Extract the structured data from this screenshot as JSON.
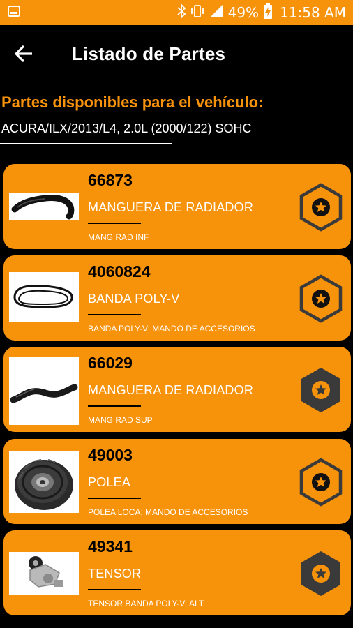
{
  "status_bar": {
    "battery_percent": "49%",
    "time": "11:58 AM",
    "icons": [
      "image-notification-icon",
      "bluetooth-icon",
      "vibrate-icon",
      "signal-icon",
      "battery-charging-icon"
    ]
  },
  "app_bar": {
    "back_icon": "arrow-left-icon",
    "title": "Listado de Partes"
  },
  "header": {
    "available_title": "Partes disponibles para el vehículo:",
    "vehicle": "ACURA/ILX/2013/L4, 2.0L (2000/122) SOHC"
  },
  "colors": {
    "accent": "#f7920b",
    "background": "#000000",
    "hex_dark": "#3a3a3a"
  },
  "parts": [
    {
      "number": "66873",
      "name": "MANGUERA DE RADIADOR",
      "description": "MANG RAD INF",
      "image": "lower-radiator-hose",
      "favorite": false
    },
    {
      "number": "4060824",
      "name": "BANDA POLY-V",
      "description": "BANDA POLY-V; MANDO DE ACCESORIOS",
      "image": "poly-v-belt",
      "favorite": false
    },
    {
      "number": "66029",
      "name": "MANGUERA DE RADIADOR",
      "description": "MANG RAD SUP",
      "image": "upper-radiator-hose",
      "favorite": true
    },
    {
      "number": "49003",
      "name": "POLEA",
      "description": "POLEA LOCA; MANDO DE ACCESORIOS",
      "image": "idler-pulley",
      "favorite": false
    },
    {
      "number": "49341",
      "name": "TENSOR",
      "description": "TENSOR BANDA POLY-V; ALT.",
      "image": "belt-tensioner",
      "favorite": true
    }
  ]
}
